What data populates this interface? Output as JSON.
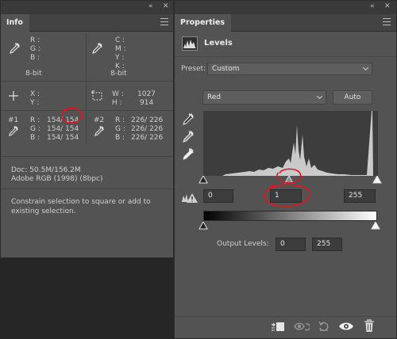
{
  "info_panel": {
    "tab_label": "Info",
    "rgb_labels": [
      "R :",
      "G :",
      "B :"
    ],
    "rgb_mode": "8-bit",
    "cmyk_labels": [
      "C :",
      "M :",
      "Y :",
      "K :"
    ],
    "cmyk_mode": "8-bit",
    "xy_labels": [
      "X :",
      "Y :"
    ],
    "wh_labels": [
      "W :",
      "H :"
    ],
    "width_value": "1027",
    "height_value": "914",
    "sampler1": {
      "label": "#1",
      "rows": [
        {
          "channel": "R :",
          "values": "154/  154"
        },
        {
          "channel": "G :",
          "values": "154/  154"
        },
        {
          "channel": "B :",
          "values": "154/  154"
        }
      ]
    },
    "sampler2": {
      "label": "#2",
      "rows": [
        {
          "channel": "R :",
          "values": "226/  226"
        },
        {
          "channel": "G :",
          "values": "226/  226"
        },
        {
          "channel": "B :",
          "values": "226/  226"
        }
      ]
    },
    "doc_size": "Doc: 50.5M/156.2M",
    "color_profile": "Adobe RGB (1998) (8bpc)",
    "tool_hint": "Constrain selection to square or add to existing selection."
  },
  "properties_panel": {
    "tab_label": "Properties",
    "adjustment_title": "Levels",
    "preset_label": "Preset:",
    "preset_value": "Custom",
    "channel_value": "Red",
    "auto_label": "Auto",
    "input_black": "0",
    "input_gamma": "1",
    "input_white": "255",
    "output_label": "Output Levels:",
    "output_black": "0",
    "output_white": "255"
  },
  "colors": {
    "annotation": "#e0141e",
    "panel_bg": "#535353",
    "histogram_bg": "#3d3d3d",
    "histogram_fill": "#cacaca"
  }
}
